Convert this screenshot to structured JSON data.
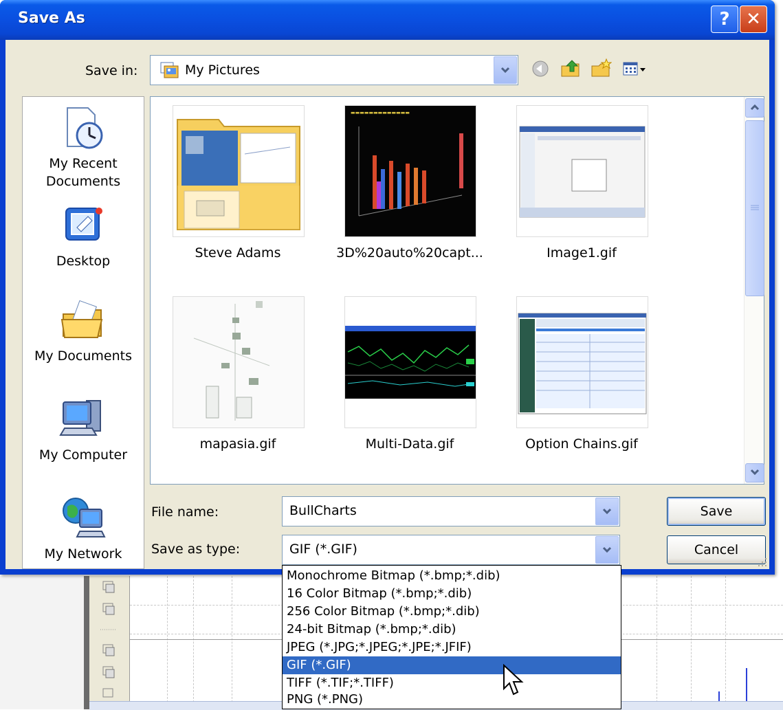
{
  "dialog": {
    "title": "Save As",
    "help_label": "?",
    "close_label": "✕"
  },
  "save_in": {
    "label": "Save in:",
    "value": "My Pictures"
  },
  "toolbar_icons": [
    "back-icon",
    "up-folder-icon",
    "new-folder-icon",
    "views-menu-icon"
  ],
  "places": [
    {
      "label_lines": [
        "My Recent",
        "Documents"
      ],
      "icon": "recent-documents-icon"
    },
    {
      "label_lines": [
        "Desktop"
      ],
      "icon": "desktop-icon"
    },
    {
      "label_lines": [
        "My Documents"
      ],
      "icon": "my-documents-icon"
    },
    {
      "label_lines": [
        "My Computer"
      ],
      "icon": "my-computer-icon"
    },
    {
      "label_lines": [
        "My Network"
      ],
      "icon": "my-network-icon"
    }
  ],
  "files": [
    {
      "name": "Steve Adams",
      "kind": "folder"
    },
    {
      "name": "3D%20auto%20capt...",
      "kind": "image"
    },
    {
      "name": "Image1.gif",
      "kind": "image"
    },
    {
      "name": "mapasia.gif",
      "kind": "image"
    },
    {
      "name": "Multi-Data.gif",
      "kind": "image"
    },
    {
      "name": "Option Chains.gif",
      "kind": "image"
    }
  ],
  "file_name": {
    "label": "File name:",
    "value": "BullCharts"
  },
  "save_as_type": {
    "label": "Save as type:",
    "value": "GIF (*.GIF)",
    "options": [
      "Monochrome Bitmap (*.bmp;*.dib)",
      "16 Color Bitmap (*.bmp;*.dib)",
      "256 Color Bitmap (*.bmp;*.dib)",
      "24-bit Bitmap (*.bmp;*.dib)",
      "JPEG (*.JPG;*.JPEG;*.JPE;*.JFIF)",
      "GIF (*.GIF)",
      "TIFF (*.TIF;*.TIFF)",
      "PNG (*.PNG)"
    ],
    "highlighted_index": 5
  },
  "buttons": {
    "save": "Save",
    "cancel": "Cancel"
  },
  "colors": {
    "titlebar": "#0a4fe0",
    "selection": "#316ac5",
    "dialog_face": "#ece9d8"
  }
}
